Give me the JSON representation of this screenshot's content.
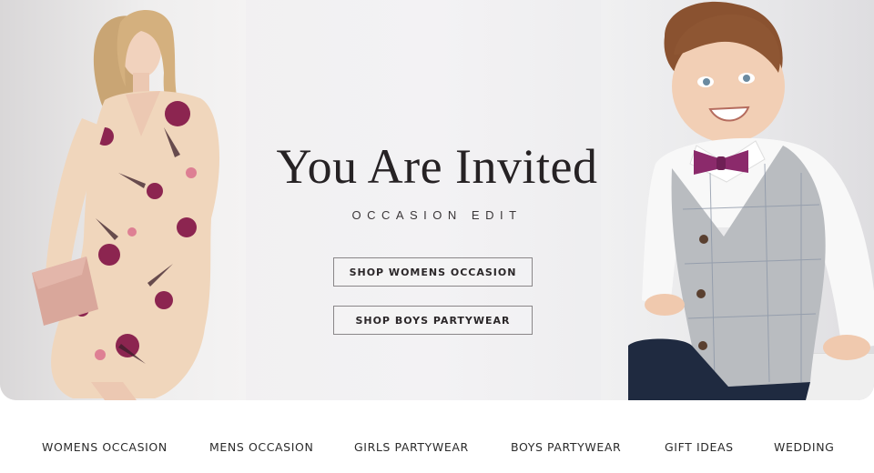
{
  "hero": {
    "headline": "You Are Invited",
    "subheadline": "OCCASION EDIT",
    "buttons": [
      {
        "label": "SHOP WOMENS OCCASION"
      },
      {
        "label": "SHOP BOYS PARTYWEAR"
      }
    ]
  },
  "nav": {
    "items": [
      {
        "label": "WOMENS OCCASION"
      },
      {
        "label": "MENS OCCASION"
      },
      {
        "label": "GIRLS PARTYWEAR"
      },
      {
        "label": "BOYS PARTYWEAR"
      },
      {
        "label": "GIFT IDEAS"
      },
      {
        "label": "WEDDING"
      }
    ]
  },
  "colors": {
    "text_dark": "#262224",
    "button_border": "#8a8688",
    "dress_base": "#f0d6bc",
    "dress_flower": "#8c2550",
    "bowtie": "#8b2a6b",
    "waistcoat": "#b9bcc0",
    "shorts": "#1f2a40"
  }
}
